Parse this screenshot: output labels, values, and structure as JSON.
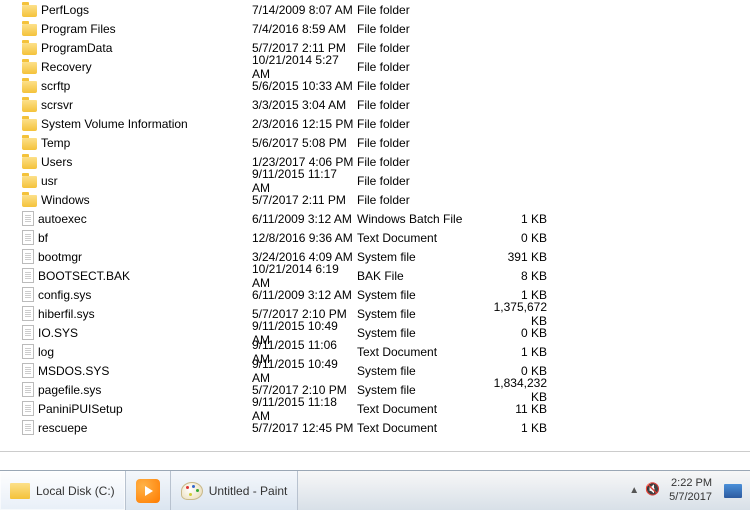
{
  "files": [
    {
      "name": "PerfLogs",
      "date": "7/14/2009 8:07 AM",
      "type": "File folder",
      "size": "",
      "icon": "folder"
    },
    {
      "name": "Program Files",
      "date": "7/4/2016 8:59 AM",
      "type": "File folder",
      "size": "",
      "icon": "folder"
    },
    {
      "name": "ProgramData",
      "date": "5/7/2017 2:11 PM",
      "type": "File folder",
      "size": "",
      "icon": "folder"
    },
    {
      "name": "Recovery",
      "date": "10/21/2014 5:27 AM",
      "type": "File folder",
      "size": "",
      "icon": "folder"
    },
    {
      "name": "scrftp",
      "date": "5/6/2015 10:33 AM",
      "type": "File folder",
      "size": "",
      "icon": "folder"
    },
    {
      "name": "scrsvr",
      "date": "3/3/2015 3:04 AM",
      "type": "File folder",
      "size": "",
      "icon": "folder"
    },
    {
      "name": "System Volume Information",
      "date": "2/3/2016 12:15 PM",
      "type": "File folder",
      "size": "",
      "icon": "folder"
    },
    {
      "name": "Temp",
      "date": "5/6/2017 5:08 PM",
      "type": "File folder",
      "size": "",
      "icon": "folder"
    },
    {
      "name": "Users",
      "date": "1/23/2017 4:06 PM",
      "type": "File folder",
      "size": "",
      "icon": "folder"
    },
    {
      "name": "usr",
      "date": "9/11/2015 11:17 AM",
      "type": "File folder",
      "size": "",
      "icon": "folder"
    },
    {
      "name": "Windows",
      "date": "5/7/2017 2:11 PM",
      "type": "File folder",
      "size": "",
      "icon": "folder"
    },
    {
      "name": "autoexec",
      "date": "6/11/2009 3:12 AM",
      "type": "Windows Batch File",
      "size": "1 KB",
      "icon": "file"
    },
    {
      "name": "bf",
      "date": "12/8/2016 9:36 AM",
      "type": "Text Document",
      "size": "0 KB",
      "icon": "file"
    },
    {
      "name": "bootmgr",
      "date": "3/24/2016 4:09 AM",
      "type": "System file",
      "size": "391 KB",
      "icon": "file"
    },
    {
      "name": "BOOTSECT.BAK",
      "date": "10/21/2014 6:19 AM",
      "type": "BAK File",
      "size": "8 KB",
      "icon": "file"
    },
    {
      "name": "config.sys",
      "date": "6/11/2009 3:12 AM",
      "type": "System file",
      "size": "1 KB",
      "icon": "file"
    },
    {
      "name": "hiberfil.sys",
      "date": "5/7/2017 2:10 PM",
      "type": "System file",
      "size": "1,375,672 KB",
      "icon": "file"
    },
    {
      "name": "IO.SYS",
      "date": "9/11/2015 10:49 AM",
      "type": "System file",
      "size": "0 KB",
      "icon": "file"
    },
    {
      "name": "log",
      "date": "9/11/2015 11:06 AM",
      "type": "Text Document",
      "size": "1 KB",
      "icon": "file"
    },
    {
      "name": "MSDOS.SYS",
      "date": "9/11/2015 10:49 AM",
      "type": "System file",
      "size": "0 KB",
      "icon": "file"
    },
    {
      "name": "pagefile.sys",
      "date": "5/7/2017 2:10 PM",
      "type": "System file",
      "size": "1,834,232 KB",
      "icon": "file"
    },
    {
      "name": "PaniniPUISetup",
      "date": "9/11/2015 11:18 AM",
      "type": "Text Document",
      "size": "11 KB",
      "icon": "file"
    },
    {
      "name": "rescuepe",
      "date": "5/7/2017 12:45 PM",
      "type": "Text Document",
      "size": "1 KB",
      "icon": "file"
    }
  ],
  "taskbar": {
    "explorer_label": "Local Disk (C:)",
    "paint_label": "Untitled - Paint"
  },
  "clock": {
    "time": "2:22 PM",
    "date": "5/7/2017"
  }
}
